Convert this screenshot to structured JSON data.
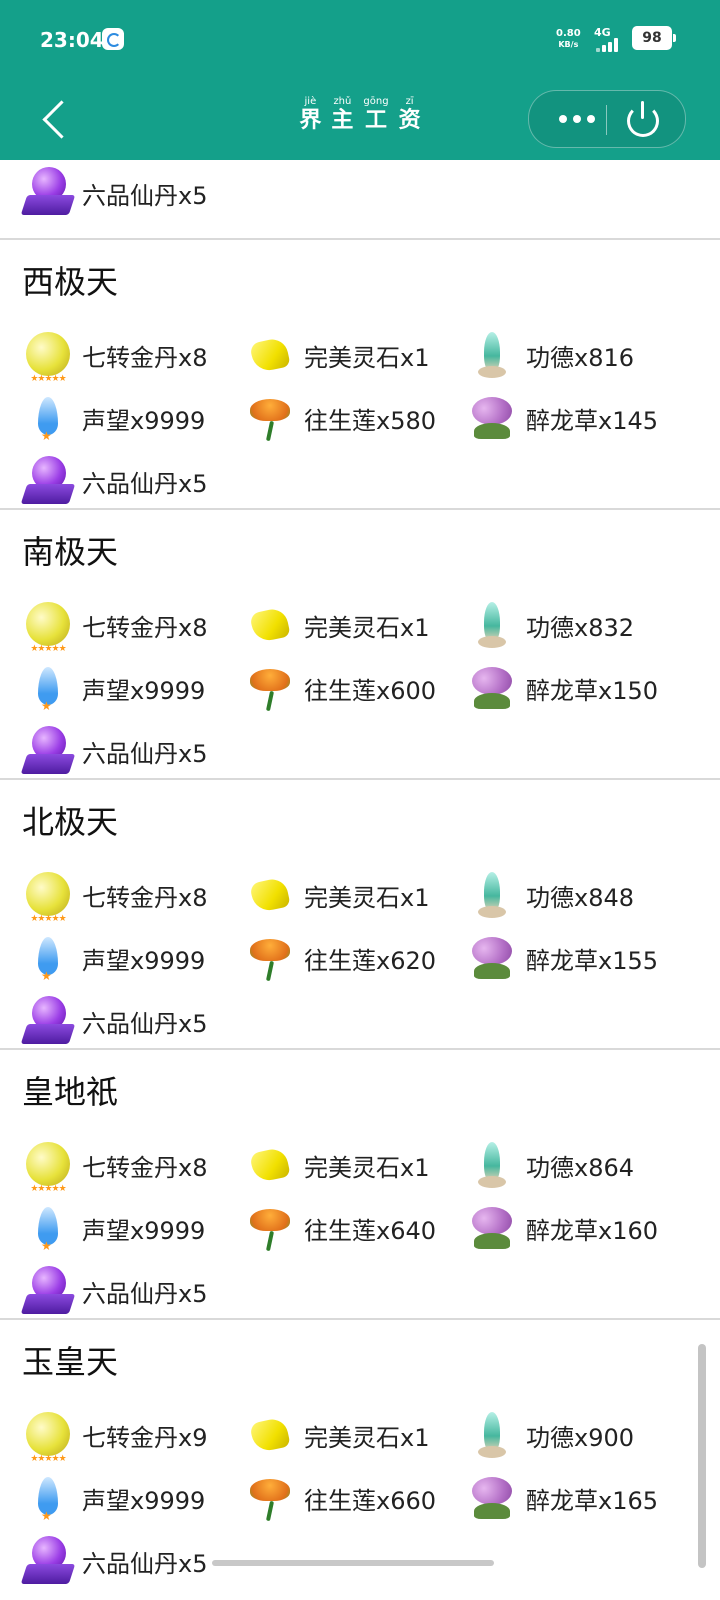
{
  "status_bar": {
    "time": "23:04",
    "net_speed": "0.80",
    "net_unit": "KB/s",
    "signal_label": "4G",
    "battery": "98"
  },
  "nav": {
    "title_chars": [
      {
        "pinyin": "jiè",
        "hanzi": "界"
      },
      {
        "pinyin": "zhǔ",
        "hanzi": "主"
      },
      {
        "pinyin": "gōng",
        "hanzi": "工"
      },
      {
        "pinyin": "zī",
        "hanzi": "资"
      }
    ]
  },
  "colors": {
    "header_bg": "#14a08a",
    "divider": "#d9d9d9"
  },
  "top_partial_section": {
    "items": [
      {
        "icon": "purple-pill-icon",
        "label": "六品仙丹x5"
      }
    ]
  },
  "sections": [
    {
      "title": "西极天",
      "items": [
        {
          "icon": "golden-pill-icon",
          "label": "七转金丹x8"
        },
        {
          "icon": "spirit-stone-icon",
          "label": "完美灵石x1"
        },
        {
          "icon": "merit-crystal-icon",
          "label": "功德x816"
        },
        {
          "icon": "prestige-flame-icon",
          "label": "声望x9999"
        },
        {
          "icon": "rebirth-lotus-icon",
          "label": "往生莲x580"
        },
        {
          "icon": "dragon-grass-icon",
          "label": "醉龙草x145"
        },
        {
          "icon": "purple-pill-icon",
          "label": "六品仙丹x5"
        }
      ]
    },
    {
      "title": "南极天",
      "items": [
        {
          "icon": "golden-pill-icon",
          "label": "七转金丹x8"
        },
        {
          "icon": "spirit-stone-icon",
          "label": "完美灵石x1"
        },
        {
          "icon": "merit-crystal-icon",
          "label": "功德x832"
        },
        {
          "icon": "prestige-flame-icon",
          "label": "声望x9999"
        },
        {
          "icon": "rebirth-lotus-icon",
          "label": "往生莲x600"
        },
        {
          "icon": "dragon-grass-icon",
          "label": "醉龙草x150"
        },
        {
          "icon": "purple-pill-icon",
          "label": "六品仙丹x5"
        }
      ]
    },
    {
      "title": "北极天",
      "items": [
        {
          "icon": "golden-pill-icon",
          "label": "七转金丹x8"
        },
        {
          "icon": "spirit-stone-icon",
          "label": "完美灵石x1"
        },
        {
          "icon": "merit-crystal-icon",
          "label": "功德x848"
        },
        {
          "icon": "prestige-flame-icon",
          "label": "声望x9999"
        },
        {
          "icon": "rebirth-lotus-icon",
          "label": "往生莲x620"
        },
        {
          "icon": "dragon-grass-icon",
          "label": "醉龙草x155"
        },
        {
          "icon": "purple-pill-icon",
          "label": "六品仙丹x5"
        }
      ]
    },
    {
      "title": "皇地祇",
      "items": [
        {
          "icon": "golden-pill-icon",
          "label": "七转金丹x8"
        },
        {
          "icon": "spirit-stone-icon",
          "label": "完美灵石x1"
        },
        {
          "icon": "merit-crystal-icon",
          "label": "功德x864"
        },
        {
          "icon": "prestige-flame-icon",
          "label": "声望x9999"
        },
        {
          "icon": "rebirth-lotus-icon",
          "label": "往生莲x640"
        },
        {
          "icon": "dragon-grass-icon",
          "label": "醉龙草x160"
        },
        {
          "icon": "purple-pill-icon",
          "label": "六品仙丹x5"
        }
      ]
    },
    {
      "title": "玉皇天",
      "items": [
        {
          "icon": "golden-pill-icon",
          "label": "七转金丹x9"
        },
        {
          "icon": "spirit-stone-icon",
          "label": "完美灵石x1"
        },
        {
          "icon": "merit-crystal-icon",
          "label": "功德x900"
        },
        {
          "icon": "prestige-flame-icon",
          "label": "声望x9999"
        },
        {
          "icon": "rebirth-lotus-icon",
          "label": "往生莲x660"
        },
        {
          "icon": "dragon-grass-icon",
          "label": "醉龙草x165"
        },
        {
          "icon": "purple-pill-icon",
          "label": "六品仙丹x5"
        }
      ]
    }
  ]
}
